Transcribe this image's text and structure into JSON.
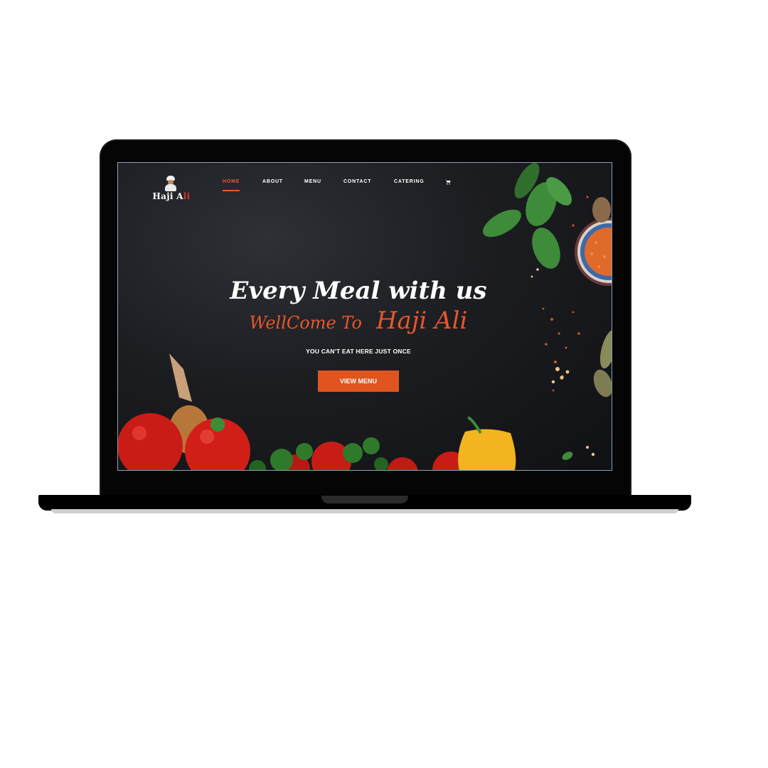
{
  "site": {
    "logo": {
      "text_main": "Haji A",
      "text_accent": "li"
    },
    "nav": {
      "items": [
        {
          "label": "HOME",
          "active": true
        },
        {
          "label": "ABOUT",
          "active": false
        },
        {
          "label": "MENU",
          "active": false
        },
        {
          "label": "CONTACT",
          "active": false
        },
        {
          "label": "CATERING",
          "active": false
        }
      ],
      "cart_icon": "cart-icon"
    },
    "hero": {
      "line1": "Every Meal with us",
      "line2_small": "WellCome To",
      "line2_big": "Haji Ali",
      "tagline": "YOU CAN'T EAT HERE JUST ONCE",
      "cta_label": "VIEW MENU"
    }
  },
  "colors": {
    "accent": "#e8572a",
    "button": "#e0541f",
    "background": "#1c1d21",
    "text": "#ffffff"
  },
  "device": "laptop-mockup"
}
